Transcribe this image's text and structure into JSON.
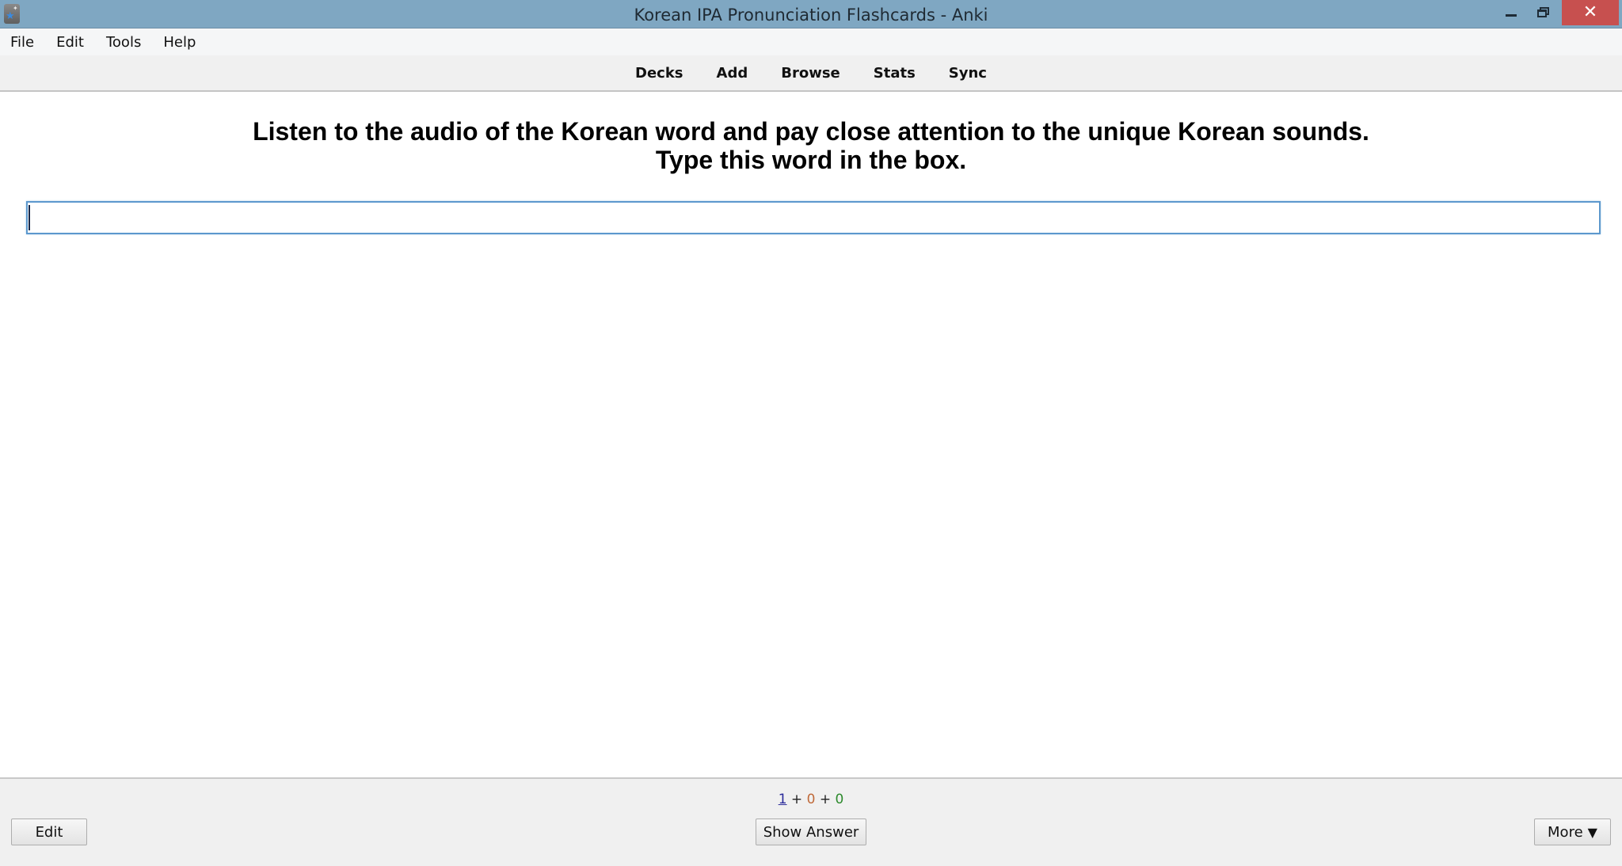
{
  "window": {
    "title": "Korean IPA Pronunciation Flashcards - Anki",
    "app_icon": "anki-star-icon",
    "controls": {
      "minimize_icon": "minimize-icon",
      "maximize_icon": "restore-icon",
      "close_glyph": "✕",
      "close_color": "#c7504f"
    }
  },
  "menubar": {
    "items": [
      "File",
      "Edit",
      "Tools",
      "Help"
    ]
  },
  "toolbar": {
    "links": [
      "Decks",
      "Add",
      "Browse",
      "Stats",
      "Sync"
    ]
  },
  "card": {
    "question_line1": "Listen to the audio of the Korean word and pay close attention to the unique Korean sounds.",
    "question_line2": "Type this word in the box.",
    "answer_input": {
      "value": "",
      "placeholder": ""
    }
  },
  "bottombar": {
    "counts": {
      "new": "1",
      "learning": "0",
      "review": "0",
      "separator": "+",
      "colors": {
        "new": "#2a2a9a",
        "learning": "#c06a3a",
        "review": "#2d8a2d"
      }
    },
    "edit_label": "Edit",
    "show_answer_label": "Show Answer",
    "more_label": "More",
    "more_icon": "▼"
  }
}
